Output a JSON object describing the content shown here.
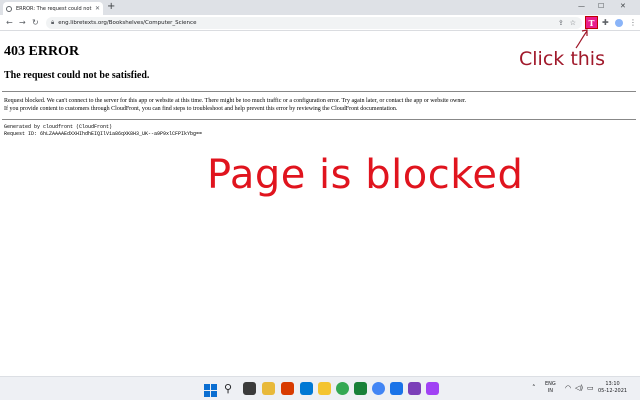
{
  "browser": {
    "tab_title": "ERROR: The request could not be",
    "url": "eng.libretexts.org/Bookshelves/Computer_Science",
    "extension_letter": "T"
  },
  "page": {
    "heading": "403 ERROR",
    "subheading": "The request could not be satisfied.",
    "message_line1": "Request blocked. We can't connect to the server for this app or website at this time. There might be too much traffic or a configuration error. Try again later, or contact the app or website owner.",
    "message_line2": "If you provide content to customers through CloudFront, you can find steps to troubleshoot and help prevent this error by reviewing the CloudFront documentation.",
    "generated_by": "Generated by cloudfront (CloudFront)",
    "request_id": "Request ID: 6hLZAAAAEdXXHIhdhEIQIlV1a86qXK8H3_UK--a9P9xlCFPIkYbg=="
  },
  "annotations": {
    "click_this": "Click this",
    "page_blocked": "Page is blocked",
    "color_click": "#a0182a",
    "color_blocked": "#e0141e"
  },
  "taskbar": {
    "lang_top": "ENG",
    "lang_bottom": "IN",
    "time": "13:10",
    "date": "05-12-2021"
  }
}
